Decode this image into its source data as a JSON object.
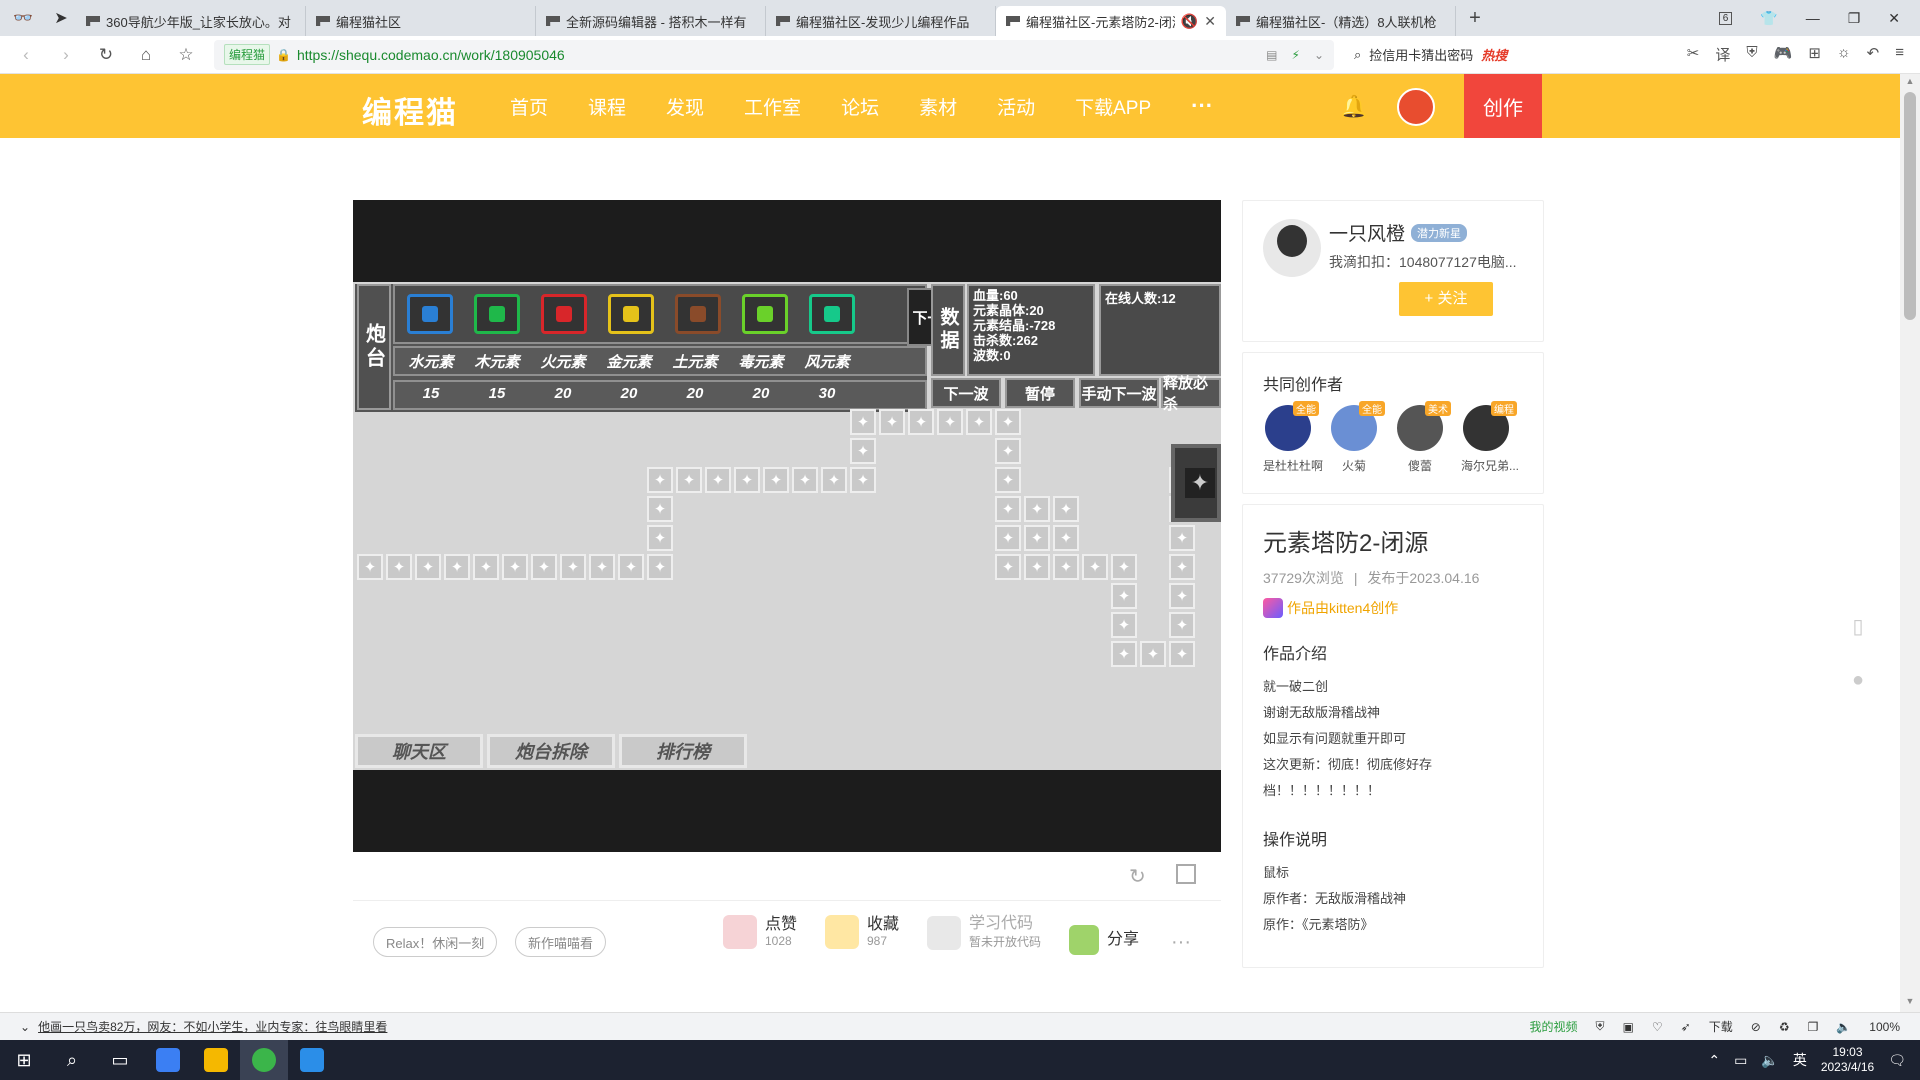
{
  "browser": {
    "tabs": [
      {
        "title": "360导航少年版_让家长放心。对"
      },
      {
        "title": "编程猫社区"
      },
      {
        "title": "全新源码编辑器 - 搭积木一样有"
      },
      {
        "title": "编程猫社区-发现少儿编程作品"
      },
      {
        "title": "编程猫社区-元素塔防2-闭源"
      },
      {
        "title": "编程猫社区-（精选）8人联机枪"
      }
    ],
    "tab_count": "6",
    "cert_label": "编程猫",
    "url": "https://shequ.codemao.cn/work/180905046",
    "search_hint": "捡信用卡猜出密码",
    "hot_label": "热搜"
  },
  "site": {
    "logo": "编程猫",
    "nav": [
      "首页",
      "课程",
      "发现",
      "工作室",
      "论坛",
      "素材",
      "活动",
      "下载APP"
    ],
    "more": "···",
    "create": "创作"
  },
  "game": {
    "turret_label": "炮台",
    "next_page": "下一页",
    "element_names": [
      "水元素",
      "木元素",
      "火元素",
      "金元素",
      "土元素",
      "毒元素",
      "风元素"
    ],
    "element_costs": [
      "15",
      "15",
      "20",
      "20",
      "20",
      "20",
      "30"
    ],
    "turret_colors": [
      "#2a7fd4",
      "#1fb84a",
      "#d8262a",
      "#e5c21a",
      "#8a4b2a",
      "#6ad12a",
      "#16c98a"
    ],
    "data_label": "数据",
    "stats": [
      "血量:60",
      "元素晶体:20",
      "元素结晶:-728",
      "击杀数:262",
      "波数:0"
    ],
    "online": "在线人数:12",
    "controls": [
      "下一波",
      "暂停",
      "手动下一波",
      "释放必杀"
    ],
    "bottom_tabs": [
      "聊天区",
      "炮台拆除",
      "排行榜"
    ]
  },
  "actions": {
    "tags": [
      "Relax！休闲一刻",
      "新作喵喵看"
    ],
    "like": {
      "label": "点赞",
      "count": "1028"
    },
    "collect": {
      "label": "收藏",
      "count": "987"
    },
    "code": {
      "label": "学习代码",
      "sub": "暂未开放代码"
    },
    "share": {
      "label": "分享"
    },
    "more": "···"
  },
  "sidebar": {
    "author": {
      "name": "一只风橙",
      "badge": "潜力新星",
      "desc": "我滴扣扣：1048077127电脑...",
      "follow": "+ 关注"
    },
    "co_title": "共同创作者",
    "co_authors": [
      {
        "name": "是杜杜杜啊",
        "tag": "全能",
        "color": "#2b3f8c"
      },
      {
        "name": "火菊",
        "tag": "全能",
        "color": "#6a8fd4"
      },
      {
        "name": "傻蕾",
        "tag": "美术",
        "color": "#555555"
      },
      {
        "name": "海尔兄弟...",
        "tag": "编程",
        "color": "#333333"
      }
    ],
    "work": {
      "title": "元素塔防2-闭源",
      "views": "37729次浏览",
      "sep": "|",
      "date": "发布于2023.04.16",
      "made_by": "作品由kitten4创作",
      "intro_title": "作品介绍",
      "intro": [
        "就一破二创",
        "谢谢无敌版滑稽战神",
        "如显示有问题就重开即可",
        "这次更新：彻底！彻底修好存",
        "档！！！！！！！！"
      ],
      "ops_title": "操作说明",
      "ops": [
        "鼠标",
        "原作者：无敌版滑稽战神",
        "原作：《元素塔防》"
      ]
    }
  },
  "statusbar": {
    "news": "他画一只鸟卖82万，网友：不如小学生，业内专家：往鸟眼睛里看",
    "my_video": "我的视频",
    "download": "下载",
    "zoom": "100%"
  },
  "taskbar": {
    "ime": "英",
    "time": "19:03",
    "date": "2023/4/16"
  }
}
